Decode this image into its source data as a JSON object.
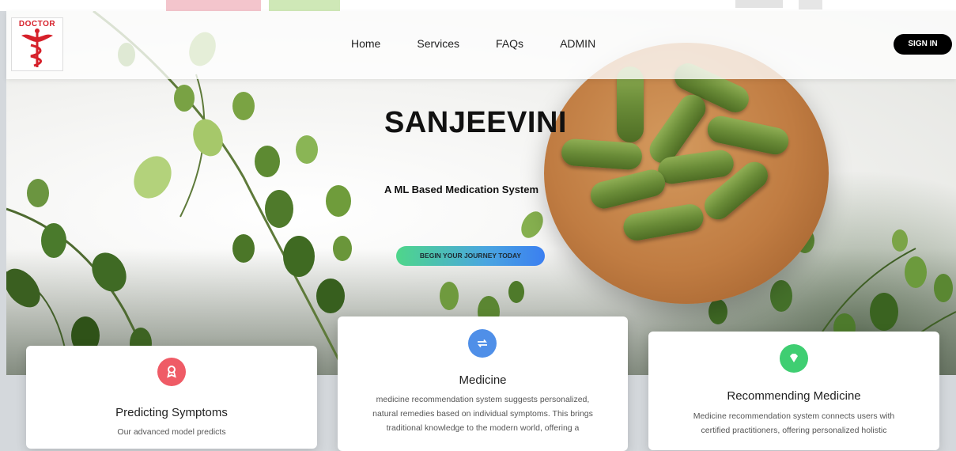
{
  "brand": {
    "logo_text": "DOCTOR"
  },
  "nav": {
    "links": [
      "Home",
      "Services",
      "FAQs",
      "ADMIN"
    ],
    "signin_label": "SIGN IN"
  },
  "hero": {
    "title": "SANJEEVINI",
    "subtitle": "A ML Based Medication System",
    "cta_label": "BEGIN YOUR JOURNEY TODAY"
  },
  "cards": [
    {
      "title": "Predicting Symptoms",
      "lines": [
        "Our advanced model predicts"
      ],
      "icon": "award-icon",
      "icon_color": "#ef5b66"
    },
    {
      "title": "Medicine",
      "lines": [
        "medicine recommendation system suggests personalized,",
        "natural remedies based on individual symptoms. This brings",
        "traditional knowledge to the modern world, offering a"
      ],
      "icon": "repeat-icon",
      "icon_color": "#4f8fe8"
    },
    {
      "title": "Recommending Medicine",
      "lines": [
        "Medicine recommendation system connects users with",
        "certified practitioners, offering personalized holistic"
      ],
      "icon": "gem-icon",
      "icon_color": "#3fce72"
    }
  ],
  "colors": {
    "signin_bg": "#000000",
    "cta_gradient_start": "#4ed68a",
    "cta_gradient_end": "#3b7ff0"
  }
}
